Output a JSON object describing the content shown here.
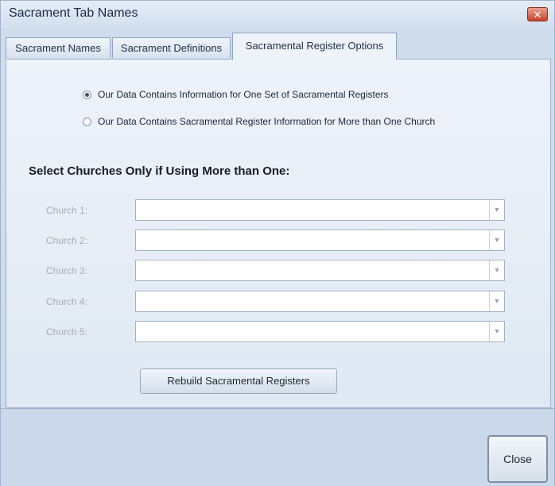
{
  "window": {
    "title": "Sacrament Tab Names",
    "close_symbol": "✕"
  },
  "tabs": [
    {
      "label": "Sacrament Names",
      "active": false
    },
    {
      "label": "Sacrament Definitions",
      "active": false
    },
    {
      "label": "Sacramental Register Options",
      "active": true
    }
  ],
  "options": {
    "radio_one": {
      "label": "Our Data Contains Information for One Set of Sacramental Registers",
      "checked": true
    },
    "radio_many": {
      "label": "Our Data Contains Sacramental Register Information for More than One Church",
      "checked": false
    }
  },
  "churches": {
    "heading": "Select Churches Only if Using More than One:",
    "items": [
      {
        "label": "Church 1:",
        "value": ""
      },
      {
        "label": "Church 2:",
        "value": ""
      },
      {
        "label": "Church 3:",
        "value": ""
      },
      {
        "label": "Church 4:",
        "value": ""
      },
      {
        "label": "Church 5:",
        "value": ""
      }
    ],
    "dropdown_icon": "chevron-down-icon"
  },
  "buttons": {
    "rebuild": "Rebuild Sacramental Registers",
    "close": "Close"
  },
  "colors": {
    "panel_bg": "#eef3fa",
    "window_bg": "#cfdcec",
    "close_accent": "#c9432a",
    "disabled_text": "#a7adb6"
  }
}
